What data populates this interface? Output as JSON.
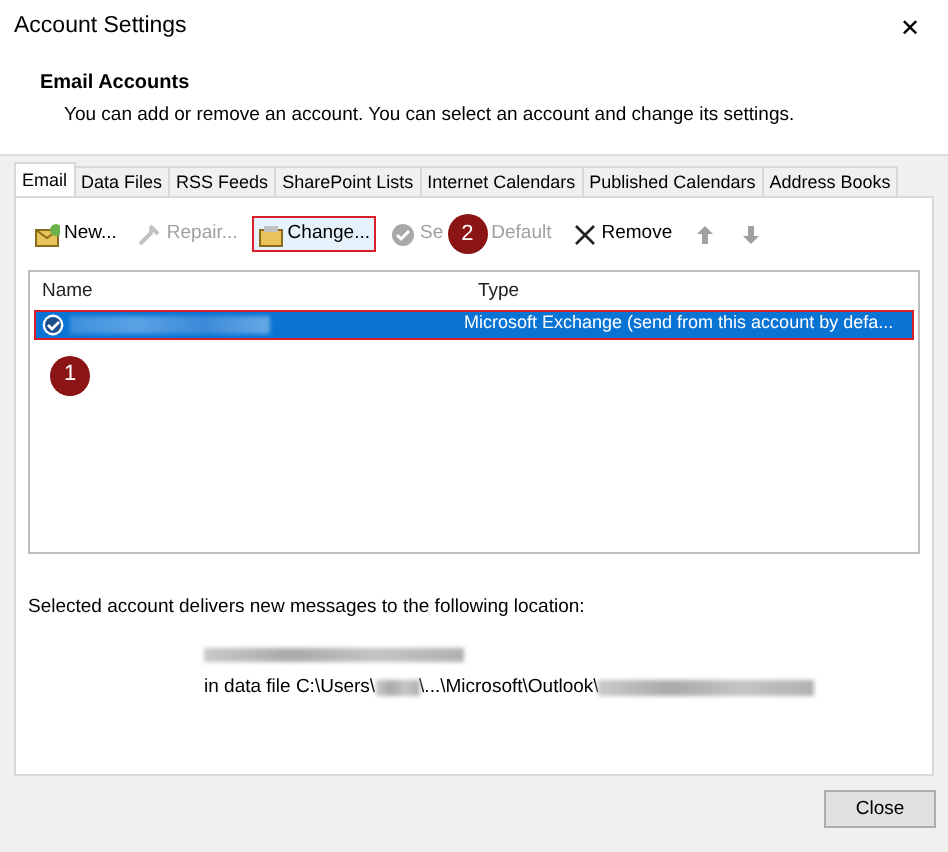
{
  "window": {
    "title": "Account Settings",
    "close": "✕"
  },
  "header": {
    "title": "Email Accounts",
    "description": "You can add or remove an account. You can select an account and change its settings."
  },
  "tabs": [
    {
      "label": "Email",
      "selected": true
    },
    {
      "label": "Data Files",
      "selected": false
    },
    {
      "label": "RSS Feeds",
      "selected": false
    },
    {
      "label": "SharePoint Lists",
      "selected": false
    },
    {
      "label": "Internet Calendars",
      "selected": false
    },
    {
      "label": "Published Calendars",
      "selected": false
    },
    {
      "label": "Address Books",
      "selected": false
    }
  ],
  "toolbar": [
    {
      "kind": "new",
      "label": "New...",
      "disabled": false,
      "highlighted": false
    },
    {
      "kind": "repair",
      "label": "Repair...",
      "disabled": true,
      "highlighted": false
    },
    {
      "kind": "change",
      "label": "Change...",
      "disabled": false,
      "highlighted": true
    },
    {
      "kind": "default",
      "label": "Se",
      "label_after": "Default",
      "disabled": true,
      "highlighted": false,
      "step": "2"
    },
    {
      "kind": "remove",
      "label": "Remove",
      "disabled": false,
      "highlighted": false
    },
    {
      "kind": "up",
      "disabled": true,
      "highlighted": false
    },
    {
      "kind": "down",
      "disabled": true,
      "highlighted": false
    }
  ],
  "table": {
    "columns": [
      "Name",
      "Type"
    ],
    "rows": [
      {
        "type": "Microsoft Exchange (send from this account by defa...",
        "selected": true,
        "default": true,
        "highlighted": true,
        "step": "1"
      }
    ]
  },
  "location": {
    "label": "Selected account delivers new messages to the following location:",
    "path_start": "in data file C:\\Users\\",
    "path_middle": "\\...\\Microsoft\\Outlook\\"
  },
  "buttons": [
    "Close"
  ]
}
